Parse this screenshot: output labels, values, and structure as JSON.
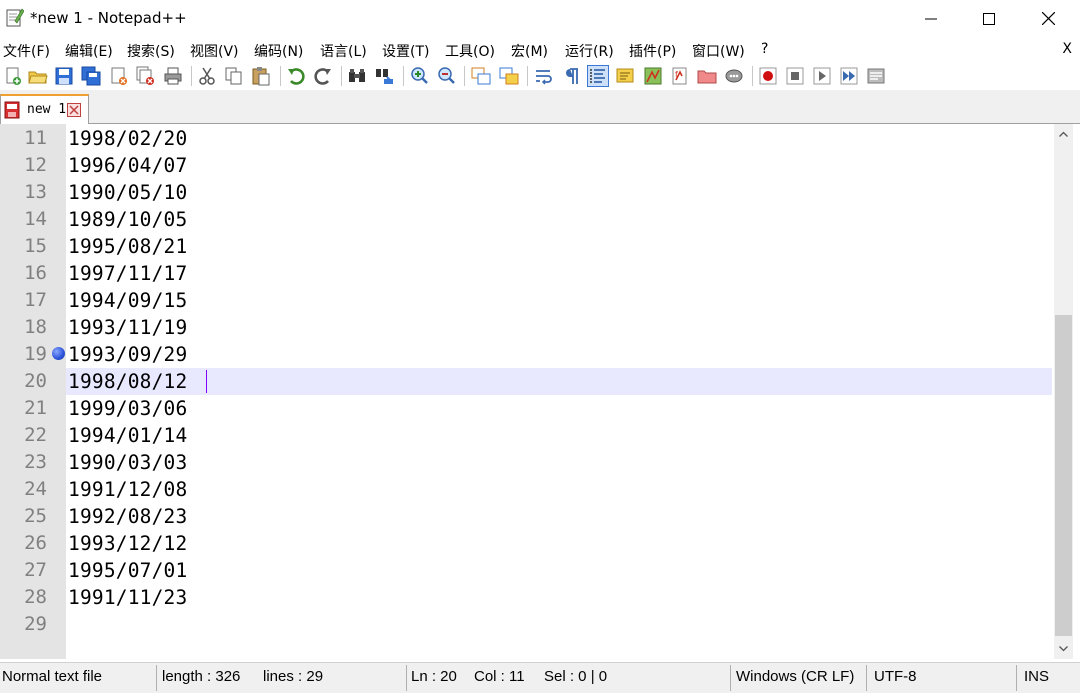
{
  "window": {
    "title": "*new 1 - Notepad++",
    "minimize": "─",
    "maximize": "☐",
    "close": "✕"
  },
  "menu": {
    "items": [
      {
        "label": "文件(F)"
      },
      {
        "label": "编辑(E)"
      },
      {
        "label": "搜索(S)"
      },
      {
        "label": "视图(V)"
      },
      {
        "label": "编码(N)"
      },
      {
        "label": "语言(L)"
      },
      {
        "label": "设置(T)"
      },
      {
        "label": "工具(O)"
      },
      {
        "label": "宏(M)"
      },
      {
        "label": "运行(R)"
      },
      {
        "label": "插件(P)"
      },
      {
        "label": "窗口(W)"
      },
      {
        "label": "?"
      }
    ],
    "close_label": "X"
  },
  "toolbar": {
    "icons": [
      "new-file-icon",
      "open-file-icon",
      "save-icon",
      "save-all-icon",
      "close-file-icon",
      "close-all-icon",
      "print-icon",
      "cut-icon",
      "copy-icon",
      "paste-icon",
      "undo-icon",
      "redo-icon",
      "find-icon",
      "replace-icon",
      "zoom-in-icon",
      "zoom-out-icon",
      "sync-vertical-icon",
      "sync-horizontal-icon",
      "word-wrap-icon",
      "show-all-chars-icon",
      "indent-guide-icon",
      "doc-map-icon",
      "function-list-icon",
      "folder-workspace-icon",
      "folder-icon",
      "monitor-icon",
      "record-macro-icon",
      "stop-macro-icon",
      "play-macro-icon",
      "run-macro-multiple-icon",
      "save-macro-icon"
    ]
  },
  "tab": {
    "label": "new 1"
  },
  "editor": {
    "lines": [
      {
        "num": "11",
        "text": "1998/02/20"
      },
      {
        "num": "12",
        "text": "1996/04/07"
      },
      {
        "num": "13",
        "text": "1990/05/10"
      },
      {
        "num": "14",
        "text": "1989/10/05"
      },
      {
        "num": "15",
        "text": "1995/08/21"
      },
      {
        "num": "16",
        "text": "1997/11/17"
      },
      {
        "num": "17",
        "text": "1994/09/15"
      },
      {
        "num": "18",
        "text": "1993/11/19"
      },
      {
        "num": "19",
        "text": "1993/09/29"
      },
      {
        "num": "20",
        "text": "1998/08/12"
      },
      {
        "num": "21",
        "text": "1999/03/06"
      },
      {
        "num": "22",
        "text": "1994/01/14"
      },
      {
        "num": "23",
        "text": "1990/03/03"
      },
      {
        "num": "24",
        "text": "1991/12/08"
      },
      {
        "num": "25",
        "text": "1992/08/23"
      },
      {
        "num": "26",
        "text": "1993/12/12"
      },
      {
        "num": "27",
        "text": "1995/07/01"
      },
      {
        "num": "28",
        "text": "1991/11/23"
      },
      {
        "num": "29",
        "text": ""
      }
    ],
    "current_line": "20",
    "bookmark_line": "19"
  },
  "status": {
    "file_type": "Normal text file",
    "length": "length : 326",
    "lines": "lines : 29",
    "ln": "Ln : 20",
    "col": "Col : 11",
    "sel": "Sel : 0 | 0",
    "eol": "Windows (CR LF)",
    "encoding": "UTF-8",
    "mode": "INS"
  },
  "colors": {
    "current_line_bg": "#e8e8ff",
    "caret": "#8000ff",
    "gutter_bg": "#e4e4e4",
    "bookmark": "#2a52d8",
    "tab_accent": "#f0a030"
  }
}
